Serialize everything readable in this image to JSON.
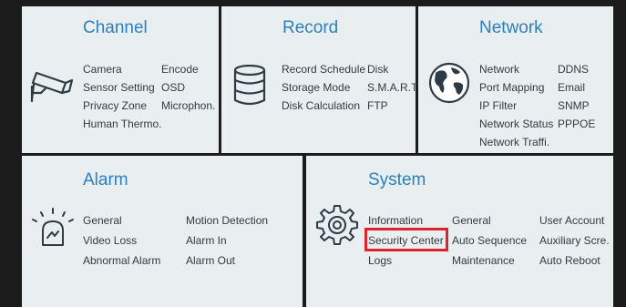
{
  "panels": {
    "channel": {
      "title": "Channel",
      "items": [
        "Camera",
        "Encode",
        "Sensor Setting",
        "OSD",
        "Privacy Zone",
        "Microphon.",
        "Human Thermo."
      ]
    },
    "record": {
      "title": "Record",
      "items": [
        "Record Schedule",
        "Disk",
        "Storage Mode",
        "S.M.A.R.T",
        "Disk Calculation",
        "FTP"
      ]
    },
    "network": {
      "title": "Network",
      "items": [
        "Network",
        "DDNS",
        "Port Mapping",
        "Email",
        "IP Filter",
        "SNMP",
        "Network Status",
        "PPPOE",
        "Network Traffi."
      ]
    },
    "alarm": {
      "title": "Alarm",
      "items": [
        "General",
        "Motion Detection",
        "Video Loss",
        "Alarm In",
        "Abnormal Alarm",
        "Alarm Out"
      ]
    },
    "system": {
      "title": "System",
      "items": [
        "Information",
        "General",
        "User Account",
        "Security Center",
        "Auto Sequence",
        "Auxiliary Scre.",
        "Logs",
        "Maintenance",
        "Auto Reboot"
      ],
      "highlighted": "Security Center"
    }
  },
  "colors": {
    "title": "#2c7fc2",
    "text": "#333a40",
    "panel_bg": "#e9eef1",
    "border": "#1b1b1b",
    "highlight": "#e0222a"
  }
}
